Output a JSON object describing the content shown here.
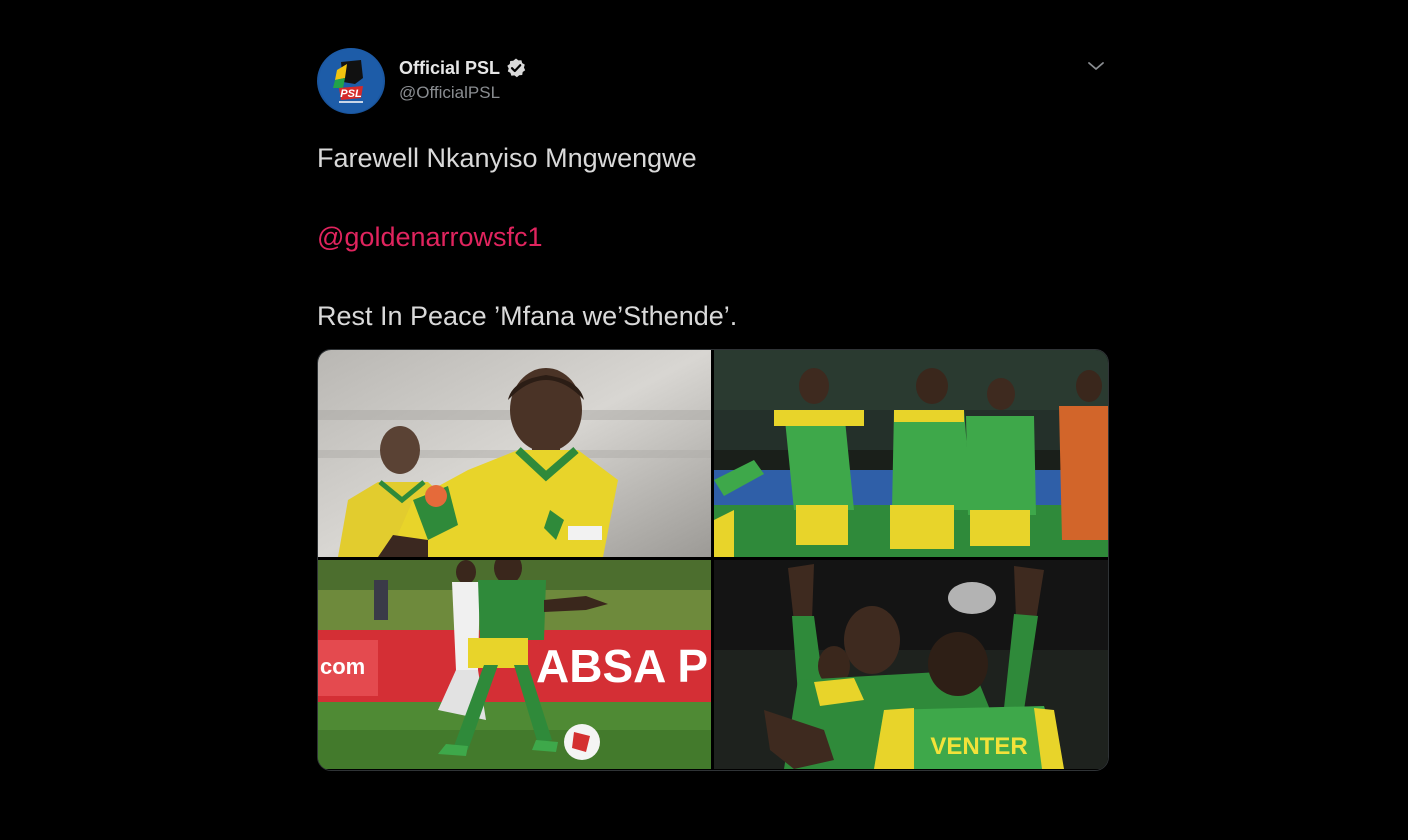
{
  "tweet": {
    "author": {
      "display_name": "Official PSL",
      "handle": "@OfficialPSL",
      "verified": true,
      "avatar_icon": "psl-logo-icon"
    },
    "menu_icon": "chevron-down-icon",
    "text": {
      "line1": "Farewell Nkanyiso Mngwengwe",
      "mention": "@goldenarrowsfc1",
      "line3": "Rest In Peace ’Mfana we’Sthende’."
    },
    "media": {
      "photos": [
        {
          "label": "photo-1"
        },
        {
          "label": "photo-2"
        },
        {
          "label": "photo-3"
        },
        {
          "label": "photo-4"
        }
      ],
      "printed_text": {
        "sponsor_board": "ABSA P",
        "sponsor_board_left": "com",
        "jersey_name": "VENTER"
      }
    }
  },
  "colors": {
    "background": "#000000",
    "text": "#d9d9d9",
    "mention": "#e0245e",
    "handle": "#8a8d91",
    "jersey_yellow": "#e8d42a",
    "jersey_green": "#2f8a3a"
  }
}
